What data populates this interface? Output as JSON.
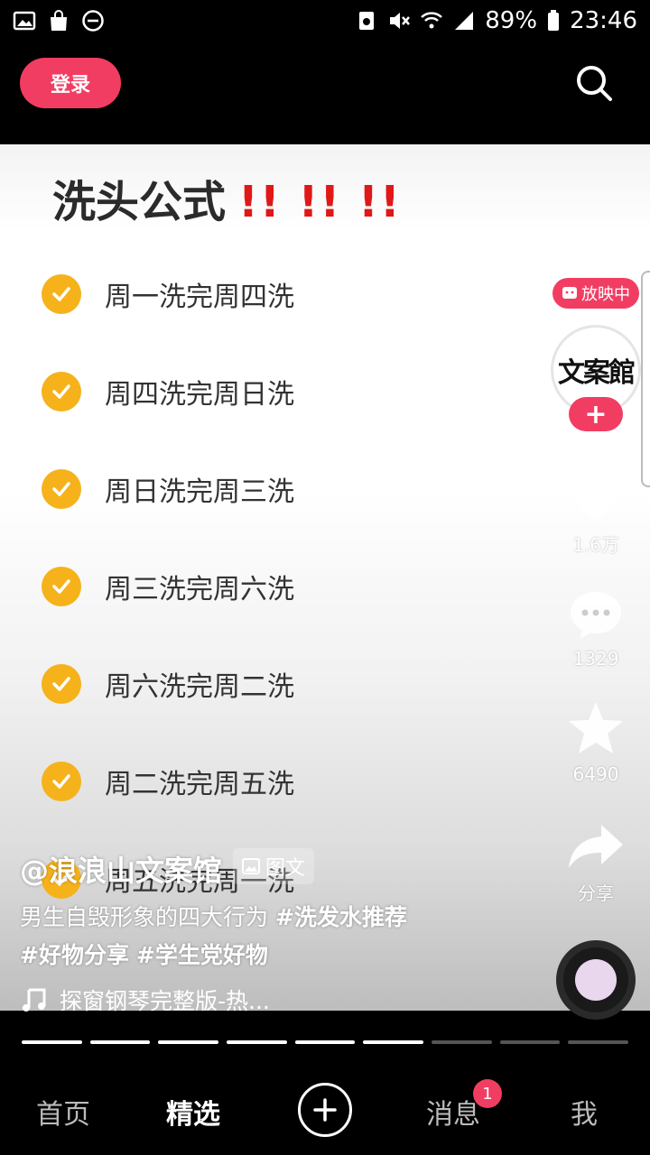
{
  "status_bar": {
    "battery": "89%",
    "time": "23:46",
    "left_icons": [
      "gallery-icon",
      "shopping-bag-icon",
      "do-not-disturb-icon"
    ],
    "right_icons": [
      "security-icon",
      "mute-icon",
      "wifi-icon",
      "signal-icon",
      "battery-icon"
    ]
  },
  "header": {
    "login_label": "登录"
  },
  "video": {
    "title": "洗头公式",
    "title_marks": "‼️‼️‼️",
    "items": [
      "周一洗完周四洗",
      "周四洗完周日洗",
      "周日洗完周三洗",
      "周三洗完周六洗",
      "周六洗完周二洗",
      "周二洗完周五洗",
      "周五洗完周一洗"
    ]
  },
  "side": {
    "live_label": "放映中",
    "avatar_text": "文案館",
    "likes": "1.6万",
    "comments": "1329",
    "favorites": "6490",
    "share_label": "分享"
  },
  "caption": {
    "author": "@浪浪山文案馆",
    "type_tag": "图文",
    "desc_text": "男生自毁形象的四大行为 ",
    "hashtags": [
      "#洗发水推荐",
      "#好物分享",
      "#学生党好物"
    ],
    "music": "探窗钢琴完整版-热..."
  },
  "progress": {
    "total": 9,
    "done": 6
  },
  "tabbar": {
    "home": "首页",
    "featured": "精选",
    "messages": "消息",
    "messages_badge": "1",
    "me": "我"
  },
  "colors": {
    "accent": "#f23d63",
    "check": "#f6b21b"
  }
}
